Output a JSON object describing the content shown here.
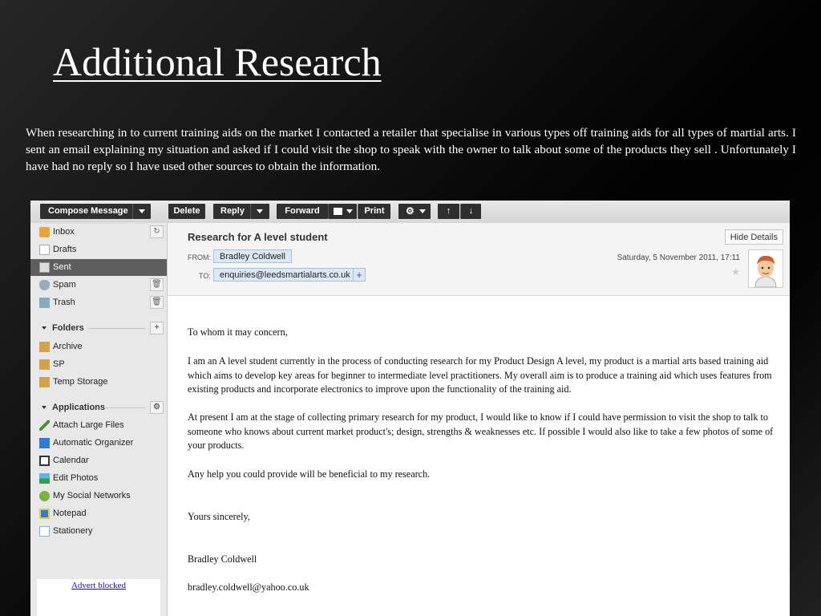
{
  "slide": {
    "title": "Additional Research",
    "text": "When researching  in to current training aids on the market I contacted a retailer that specialise in various types off  training aids for all types of martial arts. I sent an email explaining my situation and asked if  I could visit the shop to speak with the owner to talk about some of  the products they sell . Unfortunately I  have had no reply so I have used other sources to obtain the information."
  },
  "toolbar": {
    "compose": "Compose Message",
    "delete": "Delete",
    "reply": "Reply",
    "forward": "Forward",
    "print": "Print"
  },
  "sidebar": {
    "items": [
      {
        "label": "Inbox",
        "icon": "inbox-icon"
      },
      {
        "label": "Drafts",
        "icon": "drafts-icon"
      },
      {
        "label": "Sent",
        "icon": "sent-icon"
      },
      {
        "label": "Spam",
        "icon": "spam-icon"
      },
      {
        "label": "Trash",
        "icon": "trash-icon"
      }
    ],
    "folders_header": "Folders",
    "folders": [
      {
        "label": "Archive",
        "icon": "folder-icon"
      },
      {
        "label": "SP",
        "icon": "folder-icon"
      },
      {
        "label": "Temp Storage",
        "icon": "folder-icon"
      }
    ],
    "apps_header": "Applications",
    "apps": [
      {
        "label": "Attach Large Files",
        "icon": "attach-icon"
      },
      {
        "label": "Automatic Organizer",
        "icon": "organizer-icon"
      },
      {
        "label": "Calendar",
        "icon": "calendar-icon"
      },
      {
        "label": "Edit Photos",
        "icon": "photos-icon"
      },
      {
        "label": "My Social Networks",
        "icon": "social-icon"
      },
      {
        "label": "Notepad",
        "icon": "notepad-icon"
      },
      {
        "label": "Stationery",
        "icon": "stationery-icon"
      }
    ],
    "advert": "Advert blocked"
  },
  "message": {
    "subject": "Research for A level student",
    "hide_details": "Hide Details",
    "from_label": "FROM:",
    "from": "Bradley Coldwell",
    "to_label": "TO:",
    "to": "enquiries@leedsmartialarts.co.uk",
    "date": "Saturday, 5 November 2011, 17:11",
    "body": [
      "To whom it may concern,",
      "I am an A level student currently in the process of conducting research for my Product Design A level, my product is a martial arts based training aid which aims to develop key areas for beginner to intermediate level practitioners. My overall aim is to produce a training aid which uses features from existing products and incorporate electronics to improve upon the functionality of the training aid.",
      "At present I am at the stage of collecting primary research for my product, I would like to know if I could have permission to visit the shop to talk to someone who knows about current market product's; design, strengths & weaknesses etc. If possible I would also like to take a few photos of some of your products.",
      "Any help you could provide will be beneficial to my research.",
      "Yours sincerely,",
      "Bradley Coldwell",
      "bradley.coldwell@yahoo.co.uk"
    ]
  }
}
